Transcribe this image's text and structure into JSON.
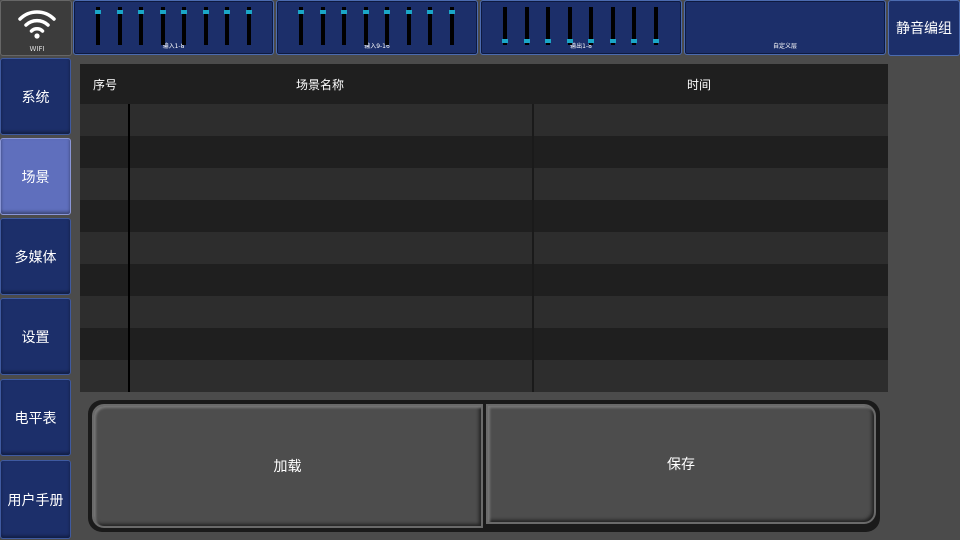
{
  "header": {
    "wifi_label": "WIFI",
    "strips": [
      {
        "label": "输入1-8",
        "levels": [
          0.9,
          0.9,
          0.9,
          0.9,
          0.9,
          0.9,
          0.9,
          0.9
        ]
      },
      {
        "label": "输入9-16",
        "levels": [
          0.9,
          0.9,
          0.9,
          0.9,
          0.9,
          0.9,
          0.9,
          0.9
        ]
      },
      {
        "label": "输出1-8",
        "levels": [
          0.05,
          0.05,
          0.05,
          0.05,
          0.05,
          0.05,
          0.05,
          0.05
        ]
      },
      {
        "label": "自定义层"
      }
    ],
    "mute_group": "静音编组"
  },
  "sidebar": {
    "items": [
      {
        "label": "系统",
        "active": false
      },
      {
        "label": "场景",
        "active": true
      },
      {
        "label": "多媒体",
        "active": false
      },
      {
        "label": "设置",
        "active": false
      },
      {
        "label": "电平表",
        "active": false
      },
      {
        "label": "用户手册",
        "active": false
      }
    ]
  },
  "table": {
    "columns": [
      "序号",
      "场景名称",
      "时间"
    ],
    "rows": 9
  },
  "actions": {
    "load": "加载",
    "save": "保存"
  },
  "colors": {
    "accent": "#1c2f6a",
    "active": "#5f6fbd",
    "fader_knob": "#1aa6c7"
  }
}
